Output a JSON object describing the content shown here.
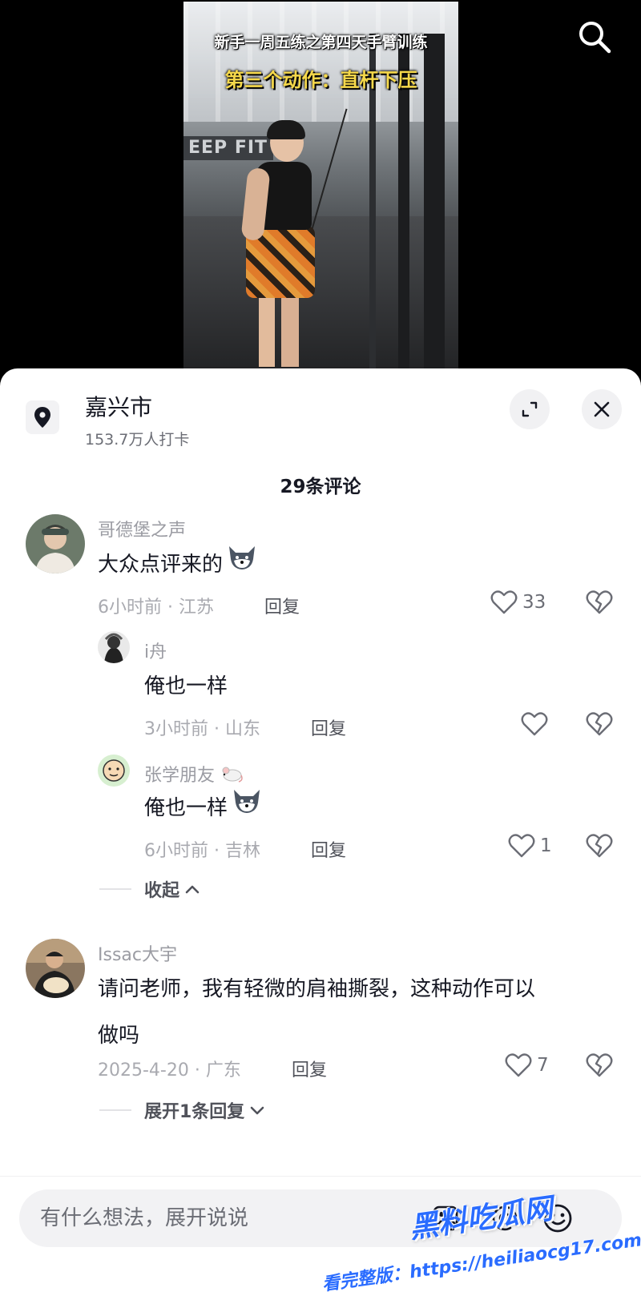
{
  "video": {
    "title": "新手一周五练之第四天手臂训练",
    "subtitle": "第三个动作：直杆下压",
    "gym_sign": "EEP FIT"
  },
  "location": {
    "name": "嘉兴市",
    "checkins": "153.7万人打卡"
  },
  "comments_header": "29条评论",
  "comments": [
    {
      "username": "哥德堡之声",
      "text": "大众点评来的",
      "time_location": "6小时前 · 江苏",
      "reply_label": "回复",
      "likes": "33",
      "replies": [
        {
          "username": "i舟",
          "text": "俺也一样",
          "time_location": "3小时前 · 山东",
          "reply_label": "回复",
          "likes": ""
        },
        {
          "username": "张学朋友",
          "text": "俺也一样",
          "time_location": "6小时前 · 吉林",
          "reply_label": "回复",
          "likes": "1"
        }
      ],
      "fold_label": "收起"
    },
    {
      "username": "Issac大宇",
      "text_line1": "请问老师，我有轻微的肩袖撕裂，这种动作可以",
      "text_line2": "做吗",
      "time_location": "2025-4-20 · 广东",
      "reply_label": "回复",
      "likes": "7",
      "expand_label": "展开1条回复"
    }
  ],
  "input": {
    "placeholder": "有什么想法，展开说说"
  },
  "watermark": {
    "title": "黑料吃瓜网",
    "url": "看完整版：https://heiliaocg17.com"
  },
  "colors": {
    "accent": "#2a6cff",
    "meta_text": "#a9aab0",
    "primary_text": "#161823",
    "subtitle_yellow": "#f5d84a"
  }
}
